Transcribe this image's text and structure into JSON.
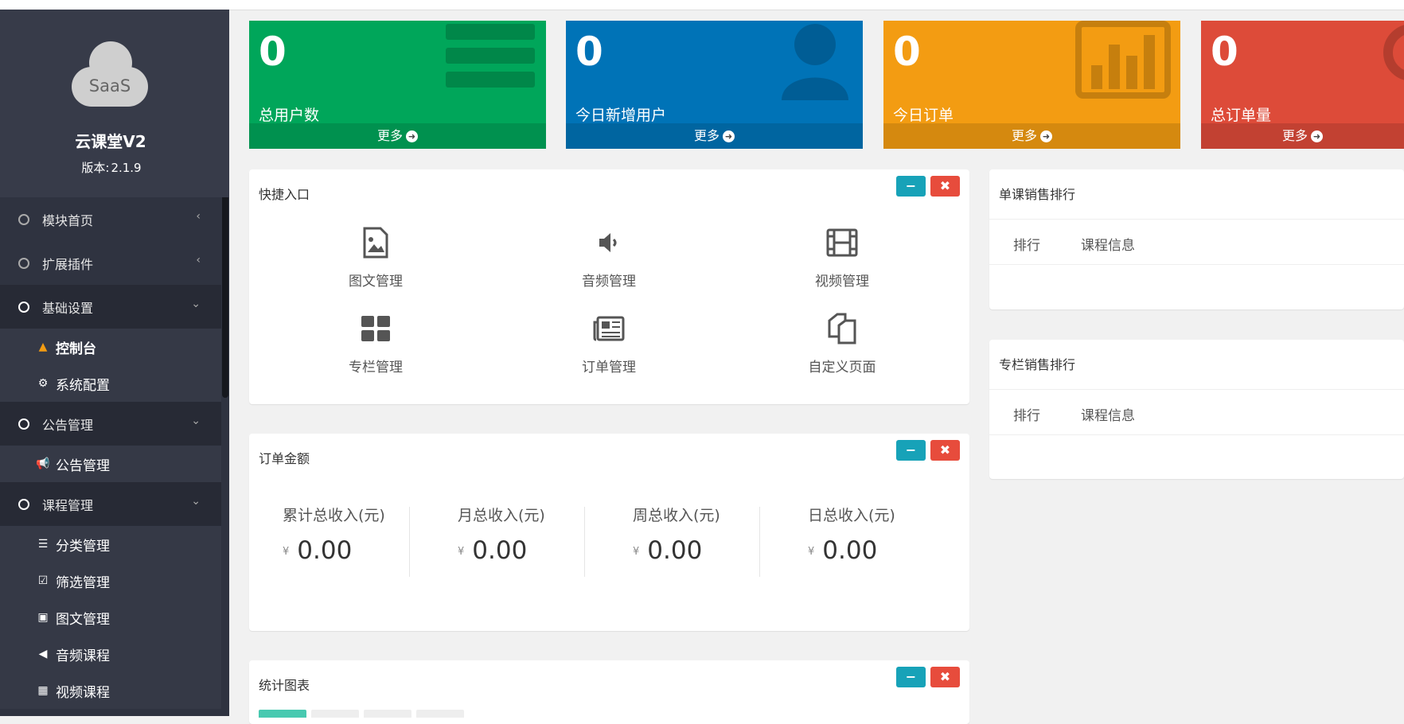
{
  "brand": {
    "logo_text": "SaaS",
    "name": "云课堂V2",
    "version_label": "版本:",
    "version_value": "2.1.9"
  },
  "sidebar": {
    "menus": [
      {
        "label": "模块首页",
        "icon": "chevron-left-icon"
      },
      {
        "label": "扩展插件",
        "icon": "chevron-left-icon"
      },
      {
        "label": "基础设置",
        "icon": "chevron-down-icon"
      },
      {
        "label": "控制台",
        "icon": "area-chart-icon"
      },
      {
        "label": "系统配置",
        "icon": "gears-icon"
      },
      {
        "label": "公告管理",
        "icon": "chevron-down-icon"
      },
      {
        "label": "公告管理",
        "icon": "bullhorn-icon"
      },
      {
        "label": "课程管理",
        "icon": "chevron-down-icon"
      },
      {
        "label": "分类管理",
        "icon": "list-icon"
      },
      {
        "label": "筛选管理",
        "icon": "check-square-icon"
      },
      {
        "label": "图文管理",
        "icon": "file-image-icon"
      },
      {
        "label": "音频课程",
        "icon": "volume-icon"
      },
      {
        "label": "视频课程",
        "icon": "film-icon"
      }
    ]
  },
  "stats": [
    {
      "value": "0",
      "label": "总用户数",
      "more": "更多",
      "color": "#00a65a",
      "icon": "table-icon"
    },
    {
      "value": "0",
      "label": "今日新增用户",
      "more": "更多",
      "color": "#0073b7",
      "icon": "user-icon"
    },
    {
      "value": "0",
      "label": "今日订单",
      "more": "更多",
      "color": "#f39c12",
      "icon": "bar-chart-icon"
    },
    {
      "value": "0",
      "label": "总订单量",
      "more": "更多",
      "color": "#dd4b39",
      "icon": "ring-icon"
    }
  ],
  "quick_panel": {
    "title": "快捷入口",
    "items": [
      {
        "label": "图文管理",
        "icon": "file-image-icon"
      },
      {
        "label": "音频管理",
        "icon": "volume-icon"
      },
      {
        "label": "视频管理",
        "icon": "film-icon"
      },
      {
        "label": "专栏管理",
        "icon": "th-large-icon"
      },
      {
        "label": "订单管理",
        "icon": "newspaper-icon"
      },
      {
        "label": "自定义页面",
        "icon": "files-icon"
      }
    ]
  },
  "revenue_panel": {
    "title": "订单金额",
    "currency": "¥",
    "items": [
      {
        "label": "累计总收入(元)",
        "value": "0.00"
      },
      {
        "label": "月总收入(元)",
        "value": "0.00"
      },
      {
        "label": "周总收入(元)",
        "value": "0.00"
      },
      {
        "label": "日总收入(元)",
        "value": "0.00"
      }
    ]
  },
  "chart_panel": {
    "title": "统计图表"
  },
  "rank_course": {
    "title": "单课销售排行",
    "col_rank": "排行",
    "col_info": "课程信息"
  },
  "rank_column": {
    "title": "专栏销售排行",
    "col_rank": "排行",
    "col_info": "课程信息"
  },
  "panel_buttons": {
    "minimize": "−",
    "close": "✖"
  }
}
